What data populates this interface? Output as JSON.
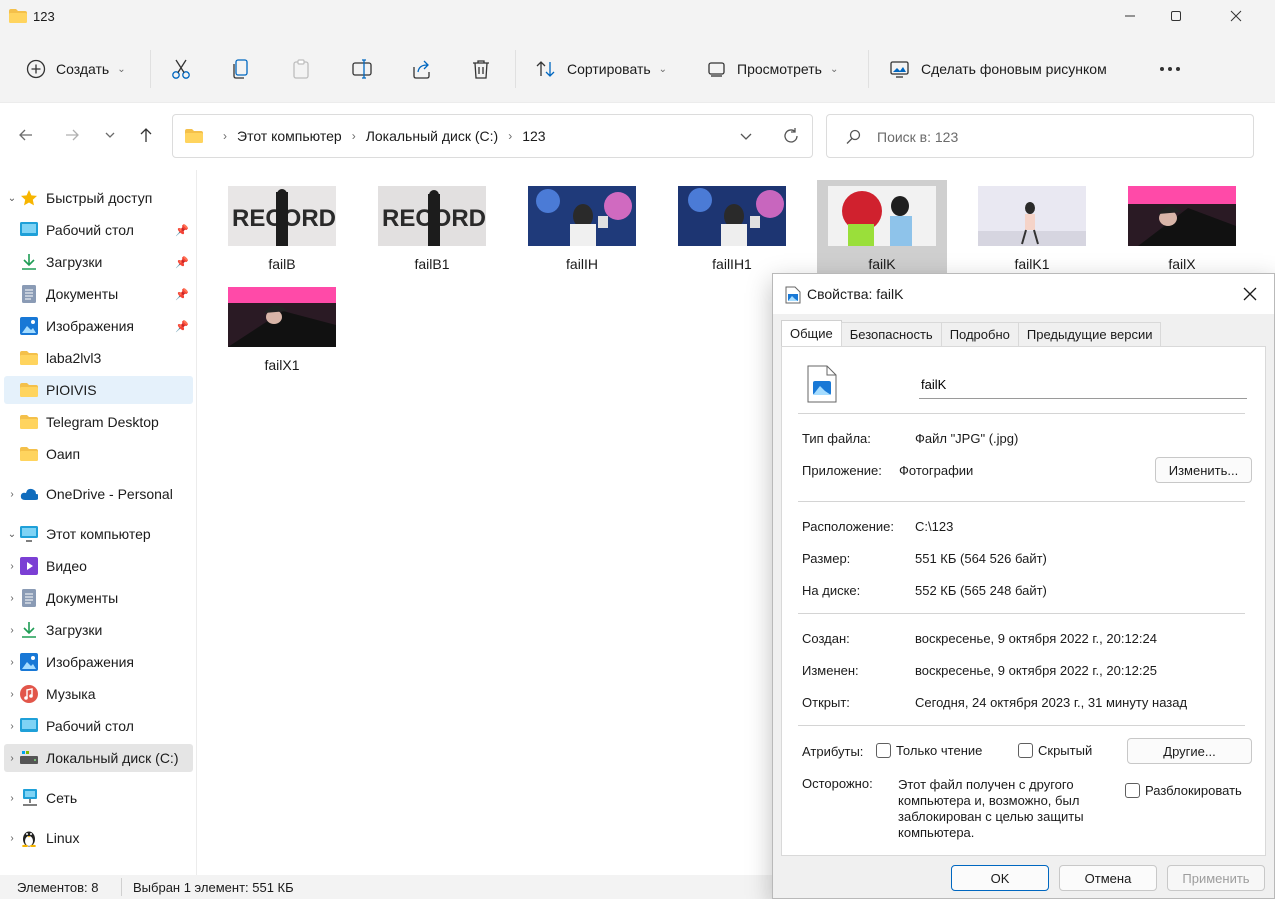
{
  "window": {
    "title": "123"
  },
  "toolbar": {
    "create": "Создать",
    "sort": "Сортировать",
    "view": "Просмотреть",
    "set_wallpaper": "Сделать фоновым рисунком"
  },
  "address": {
    "crumbs": [
      "Этот компьютер",
      "Локальный диск (C:)",
      "123"
    ],
    "search_placeholder": "Поиск в: 123"
  },
  "sidebar": {
    "quick_access": "Быстрый доступ",
    "quick_items": [
      "Рабочий стол",
      "Загрузки",
      "Документы",
      "Изображения",
      "laba2lvl3",
      "PIOIVIS",
      "Telegram Desktop",
      "Оаип"
    ],
    "onedrive": "OneDrive - Personal",
    "this_pc": "Этот компьютер",
    "pc_items": [
      "Видео",
      "Документы",
      "Загрузки",
      "Изображения",
      "Музыка",
      "Рабочий стол",
      "Локальный диск (C:)"
    ],
    "network": "Сеть",
    "linux": "Linux"
  },
  "files": [
    "failB",
    "failB1",
    "failIH",
    "failIH1",
    "failK",
    "failK1",
    "failX",
    "failX1"
  ],
  "status": {
    "count": "Элементов: 8",
    "selection": "Выбран 1 элемент: 551 КБ"
  },
  "dialog": {
    "title": "Свойства: failK",
    "tabs": [
      "Общие",
      "Безопасность",
      "Подробно",
      "Предыдущие версии"
    ],
    "filename": "failK",
    "type_label": "Тип файла:",
    "type_value": "Файл \"JPG\" (.jpg)",
    "app_label": "Приложение:",
    "app_value": "Фотографии",
    "change_button": "Изменить...",
    "location_label": "Расположение:",
    "location_value": "C:\\123",
    "size_label": "Размер:",
    "size_value": "551 КБ (564 526 байт)",
    "ondisk_label": "На диске:",
    "ondisk_value": "552 КБ (565 248 байт)",
    "created_label": "Создан:",
    "created_value": "воскресенье, 9 октября 2022 г., 20:12:24",
    "modified_label": "Изменен:",
    "modified_value": "воскресенье, 9 октября 2022 г., 20:12:25",
    "opened_label": "Открыт:",
    "opened_value": "Сегодня, 24 октября 2023 г., 31 минуту назад",
    "attributes_label": "Атрибуты:",
    "readonly_label": "Только чтение",
    "hidden_label": "Скрытый",
    "other_button": "Другие...",
    "caution_label": "Осторожно:",
    "caution_text": "Этот файл получен с другого компьютера и, возможно, был заблокирован с целью защиты компьютера.",
    "unblock_label": "Разблокировать",
    "ok": "OK",
    "cancel": "Отмена",
    "apply": "Применить"
  }
}
